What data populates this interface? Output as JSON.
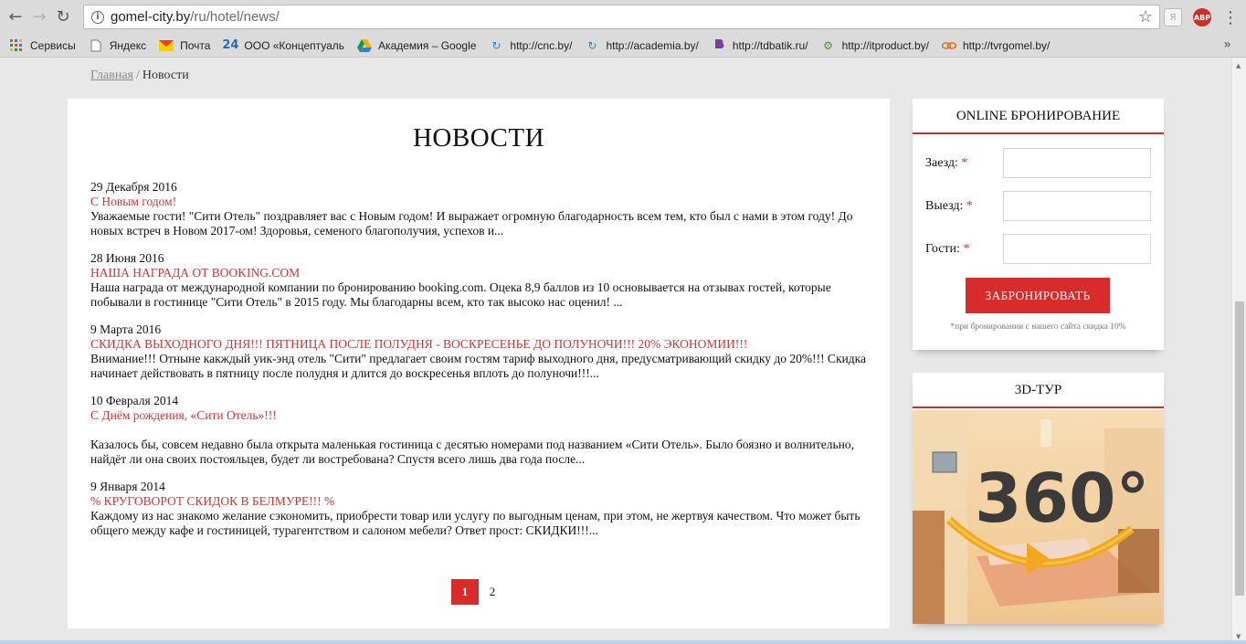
{
  "browser": {
    "url_host": "gomel-city.by",
    "url_path": "/ru/hotel/news/",
    "bookmarks": [
      {
        "label": "Сервисы",
        "icon": "apps-grid-icon"
      },
      {
        "label": "Яндекс",
        "icon": "page-icon"
      },
      {
        "label": "Почта",
        "icon": "mail-icon"
      },
      {
        "label": "ООО «Концептуаль",
        "icon": "number-24-icon"
      },
      {
        "label": "Академия – Google",
        "icon": "google-drive-icon"
      },
      {
        "label": "http://cnc.by/",
        "icon": "refresh-site-icon"
      },
      {
        "label": "http://academia.by/",
        "icon": "refresh-site-icon"
      },
      {
        "label": "http://tdbatik.ru/",
        "icon": "batik-logo-icon"
      },
      {
        "label": "http://itproduct.by/",
        "icon": "gear-site-icon"
      },
      {
        "label": "http://tvrgomel.by/",
        "icon": "link-site-icon"
      }
    ],
    "extension_ya": "Я",
    "extension_abp": "ABP"
  },
  "breadcrumb": {
    "home": "Главная",
    "separator": "/",
    "current": "Новости"
  },
  "page_title": "НОВОСТИ",
  "news": [
    {
      "date": "29 Декабря 2016",
      "title": "С Новым годом!",
      "text": "Уважаемые гости! \"Сити Отель\" поздравляет вас с Новым годом! И выражает огромную благодарность всем тем, кто был с нами в этом году! До новых встреч в Новом 2017-ом! Здоровья, семеного благополучия, успехов и..."
    },
    {
      "date": "28 Июня 2016",
      "title": "НАША НАГРАДА ОТ BOOKING.COM",
      "text": "Наша награда от международной компании по бронированию booking.com. Оцека 8,9 баллов из 10 основывается на отзывах гостей, которые побывали в гостинице \"Сити Отель\" в 2015 году. Мы благодарны всем, кто так высоко нас оценил! ..."
    },
    {
      "date": "9 Марта 2016",
      "title": "СКИДКА ВЫХОДНОГО ДНЯ!!! ПЯТНИЦА ПОСЛЕ ПОЛУДНЯ - ВОСКРЕСЕНЬЕ ДО ПОЛУНОЧИ!!! 20% ЭКОНОМИИ!!!",
      "text": "Внимание!!! Отныне какждый уик-энд отель \"Сити\" предлагает своим гостям тариф выходного дня, предусматривающий скидку до 20%!!! Скидка начинает действовать в пятницу после полудня и длится  до воскресенья вплоть до полуночи!!!..."
    },
    {
      "date": "10 Февраля 2014",
      "title": "С Днём рождения, «Сити Отель»!!!",
      "text": "Казалось бы, совсем недавно была открыта маленькая гостиница с десятью номерами под названием «Сити Отель». Было боязно и волнительно, найдёт ли она своих постояльцев, будет ли востребована? Спустя всего лишь два года после..."
    },
    {
      "date": "9 Января 2014",
      "title": "% КРУГОВОРОТ СКИДОК В БЕЛМУРЕ!!! %",
      "text": "Каждому из нас знакомо желание сэкономить, приобрести товар или услугу по выгодным ценам, при этом, не жертвуя качеством. Что может быть общего между кафе и гостиницей, турагентством и салоном мебели?  Ответ прост: СКИДКИ!!!..."
    }
  ],
  "pagination": {
    "pages": [
      "1",
      "2"
    ],
    "active": "1"
  },
  "booking": {
    "title": "ONLINE БРОНИРОВАНИЕ",
    "checkin_label": "Заезд:",
    "checkout_label": "Выезд:",
    "guests_label": "Гости:",
    "required_mark": "*",
    "button": "ЗАБРОНИРОВАТЬ",
    "note": "*при бронировании с нашего сайта скидка 10%"
  },
  "tour": {
    "title": "3D-ТУР",
    "badge": "360°"
  },
  "colors": {
    "accent": "#d82b2b",
    "link_red": "#d63333",
    "background": "#e8e8e8"
  }
}
